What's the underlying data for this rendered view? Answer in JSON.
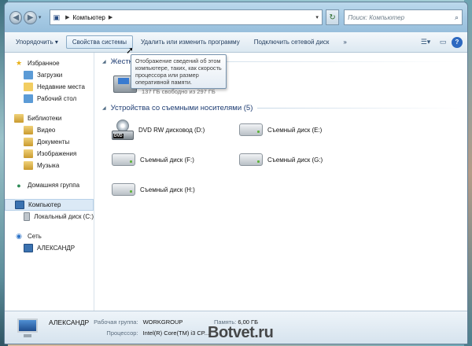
{
  "address": {
    "crumb": "Компьютер"
  },
  "search": {
    "placeholder": "Поиск: Компьютер"
  },
  "toolbar": {
    "organize": "Упорядочить ▾",
    "system_props": "Свойства системы",
    "uninstall": "Удалить или изменить программу",
    "map_drive": "Подключить сетевой диск",
    "more": "»"
  },
  "nav": {
    "favorites": {
      "label": "Избранное",
      "items": [
        "Загрузки",
        "Недавние места",
        "Рабочий стол"
      ]
    },
    "libraries": {
      "label": "Библиотеки",
      "items": [
        "Видео",
        "Документы",
        "Изображения",
        "Музыка"
      ]
    },
    "homegroup": "Домашняя группа",
    "computer": {
      "label": "Компьютер",
      "items": [
        "Локальный диск (C:)"
      ]
    },
    "network": {
      "label": "Сеть",
      "items": [
        "АЛЕКСАНДР"
      ]
    }
  },
  "content": {
    "hdd_group": "Жестки",
    "hdd_free": "137 ГБ свободно из 297 ГБ",
    "removable_group": "Устройства со съемными носителями (5)",
    "drives": [
      "DVD RW дисковод (D:)",
      "Съемный диск (E:)",
      "Съемный диск (F:)",
      "Съемный диск (G:)",
      "Съемный диск (H:)"
    ],
    "tooltip": "Отображение сведений об этом компьютере, таких, как скорость процессора или размер оперативной памяти."
  },
  "details": {
    "name": "АЛЕКСАНДР",
    "workgroup_key": "Рабочая группа:",
    "workgroup_val": "WORKGROUP",
    "memory_key": "Память:",
    "memory_val": "6,00 ГБ",
    "cpu_key": "Процессор:",
    "cpu_val": "Intel(R) Core(TM) i3 CP..."
  },
  "watermark": "Botvet.ru"
}
